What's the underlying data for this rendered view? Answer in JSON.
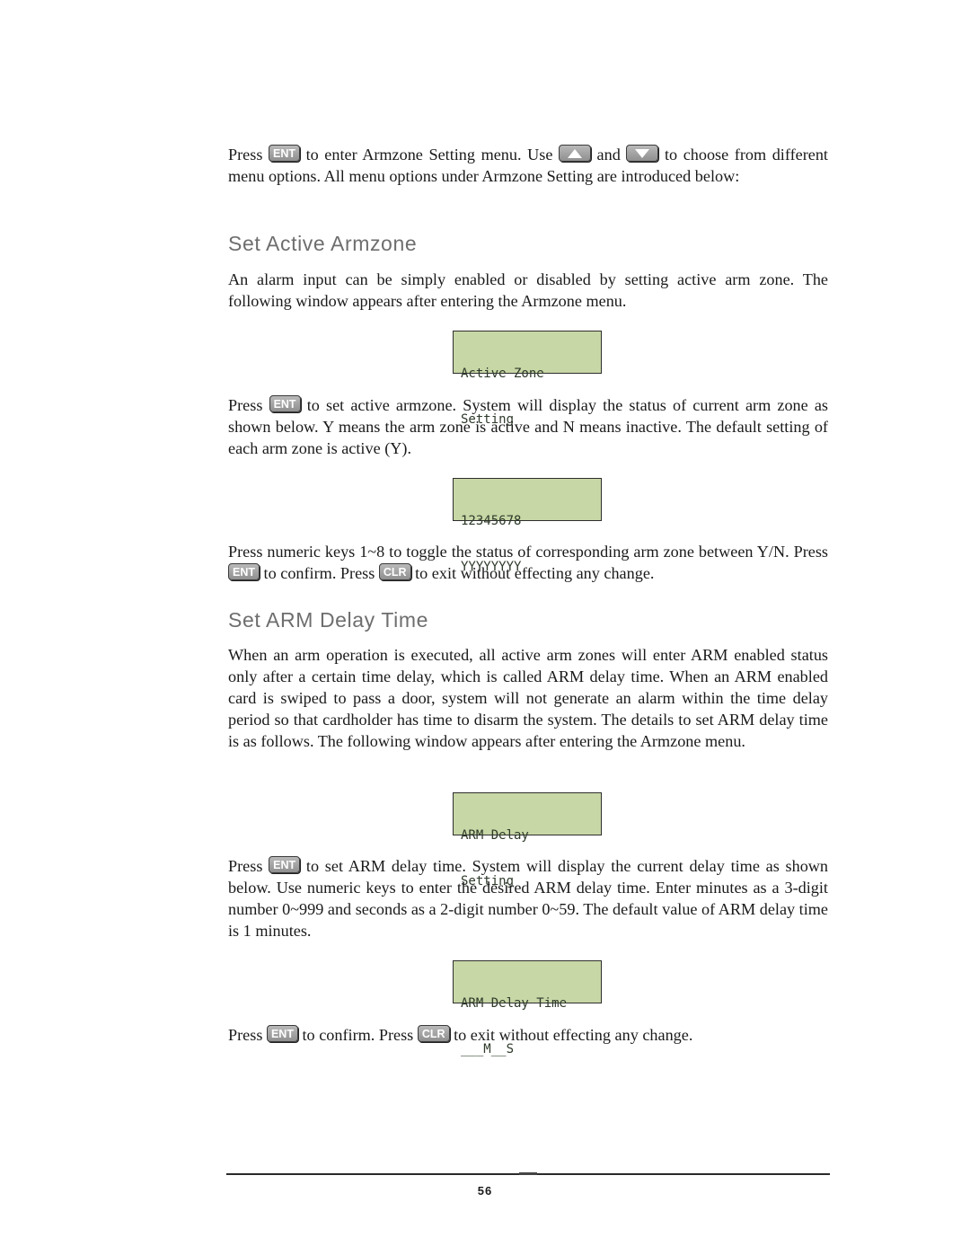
{
  "intro": {
    "press": "Press",
    "ent_key": "ENT",
    "text1": "to enter Armzone Setting menu. Use",
    "up_key_icon": "up-arrow-key",
    "and": "and",
    "down_key_icon": "down-arrow-key",
    "text2": "to choose from different menu options. All menu options under Armzone Setting are introduced below:"
  },
  "section_active": {
    "heading": "Set Active Armzone",
    "para1": "An alarm input can be simply enabled or disabled by setting active arm zone. The following window appears after entering the Armzone menu.",
    "lcd1": {
      "line1": "Active Zone",
      "line2": "Setting"
    },
    "para2_press": "Press",
    "ent_key": "ENT",
    "para2_rest": "to set active armzone. System will display the status of current arm zone as shown below. Y means the arm zone is active and N means inactive. The default setting of each arm zone is active (Y).",
    "lcd2": {
      "line1": "12345678",
      "line2": "YYYYYYYY"
    },
    "para3_a": "Press numeric keys 1~8 to toggle the status of corresponding arm zone between Y/N. Press",
    "para3_b": "to confirm. Press",
    "clr_key": "CLR",
    "para3_c": "to exit without effecting any change."
  },
  "section_delay": {
    "heading": "Set ARM Delay Time",
    "para1": "When an arm operation is executed, all active arm zones will enter ARM enabled status only after a certain time delay, which is called ARM delay time. When an ARM enabled card is swiped to pass a door, system will not generate an alarm within the time delay period so that cardholder has time to disarm the system. The details to set ARM delay time is as follows. The following window appears after entering the Armzone menu.",
    "lcd1": {
      "line1": "ARM Delay",
      "line2": "Setting"
    },
    "para2_press": "Press",
    "ent_key": "ENT",
    "para2_rest": "to set ARM delay time. System will display the current delay time as shown below. Use numeric keys to enter the desired ARM delay time. Enter minutes as a 3-digit number 0~999 and seconds as a 2-digit number 0~59. The default value of ARM delay time is 1 minutes.",
    "lcd2": {
      "line1": "ARM Delay Time",
      "line2": "___M__S"
    },
    "para3_press": "Press",
    "para3_b": "to confirm. Press",
    "clr_key": "CLR",
    "para3_c": "to exit without effecting any change."
  },
  "footer": {
    "page_number": "56"
  }
}
